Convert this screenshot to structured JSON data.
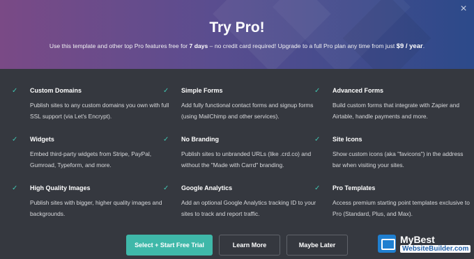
{
  "dialog": {
    "close_glyph": "×",
    "title": "Try Pro!",
    "subtitle": {
      "before": "Use this template and other top Pro features free for ",
      "days": "7 days",
      "middle": " – no credit card required! Upgrade to a full Pro plan any time from just ",
      "price": "$9 / year",
      "end": "."
    }
  },
  "features": [
    {
      "title": "Custom Domains",
      "desc": "Publish sites to any custom domains you own with full SSL support (via Let's Encrypt)."
    },
    {
      "title": "Simple Forms",
      "desc": "Add fully functional contact forms and signup forms (using MailChimp and other services)."
    },
    {
      "title": "Advanced Forms",
      "desc": "Build custom forms that integrate with Zapier and Airtable, handle payments and more."
    },
    {
      "title": "Widgets",
      "desc": "Embed third-party widgets from Stripe, PayPal, Gumroad, Typeform, and more."
    },
    {
      "title": "No Branding",
      "desc": "Publish sites to unbranded URLs (like .crd.co) and without the \"Made with Carrd\" branding."
    },
    {
      "title": "Site Icons",
      "desc": "Show custom icons (aka \"favicons\") in the address bar when visiting your sites."
    },
    {
      "title": "High Quality Images",
      "desc": "Publish sites with bigger, higher quality images and backgrounds."
    },
    {
      "title": "Google Analytics",
      "desc": "Add an optional Google Analytics tracking ID to your sites to track and report traffic."
    },
    {
      "title": "Pro Templates",
      "desc": "Access premium starting point templates exclusive to Pro (Standard, Plus, and Max)."
    }
  ],
  "check_glyph": "✓",
  "buttons": {
    "primary": "Select + Start Free Trial",
    "learn": "Learn More",
    "later": "Maybe Later"
  },
  "watermark": {
    "line1": "MyBest",
    "line2": "WebsiteBuilder.com"
  },
  "colors": {
    "accent": "#3fb8a9",
    "check": "#40c4b0",
    "body_bg": "#35383f"
  }
}
